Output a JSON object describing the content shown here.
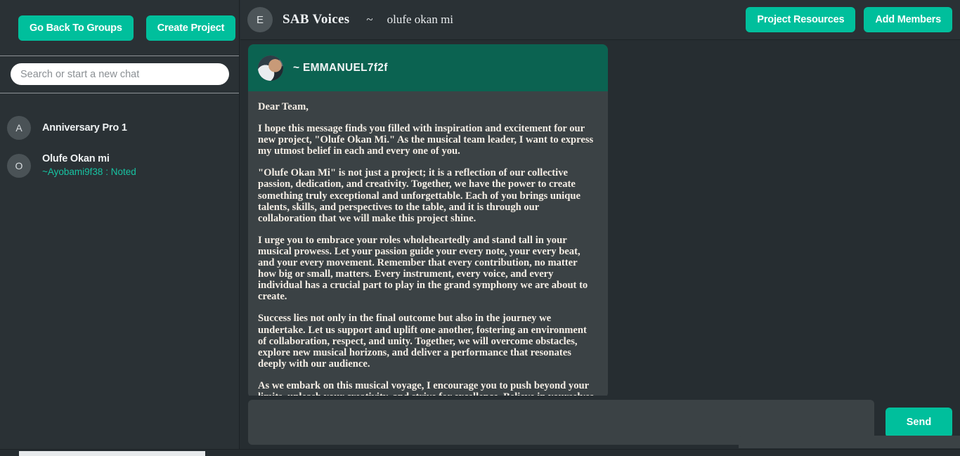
{
  "colors": {
    "accent": "#00bf9c",
    "app_bg": "#262d31",
    "panel_bg": "#2a3135",
    "card_bg": "#3b4245",
    "message_header_bg": "#0b6351",
    "sub_text": "#17c3a2",
    "body_text": "#f4ede4"
  },
  "sidebar": {
    "buttons": [
      {
        "label": "Go Back To Groups",
        "name": "go-back-to-groups-button"
      },
      {
        "label": "Create Project",
        "name": "create-project-button"
      }
    ],
    "search": {
      "placeholder": "Search or start a new chat",
      "value": ""
    },
    "chats": [
      {
        "avatar_initial": "A",
        "name": "Anniversary Pro 1",
        "preview": ""
      },
      {
        "avatar_initial": "O",
        "name": "Olufe Okan mi",
        "preview": "~Ayobami9f38 : Noted"
      }
    ]
  },
  "header": {
    "avatar_initial": "E",
    "title": "SAB Voices",
    "separator": "~",
    "subtitle": "olufe okan mi",
    "buttons": [
      {
        "label": "Project Resources",
        "name": "project-resources-button"
      },
      {
        "label": "Add Members",
        "name": "add-members-button"
      }
    ]
  },
  "message": {
    "sender": "~ EMMANUEL7f2f",
    "avatar_icon": "user-photo-avatar",
    "paragraphs": [
      "Dear Team,",
      "I hope this message finds you filled with inspiration and excitement for our new project, \"Olufe Okan Mi.\" As the musical team leader, I want to express my utmost belief in each and every one of you.",
      "\"Olufe Okan Mi\" is not just a project; it is a reflection of our collective passion, dedication, and creativity. Together, we have the power to create something truly exceptional and unforgettable. Each of you brings unique talents, skills, and perspectives to the table, and it is through our collaboration that we will make this project shine.",
      "I urge you to embrace your roles wholeheartedly and stand tall in your musical prowess. Let your passion guide your every note, your every beat, and your every movement. Remember that every contribution, no matter how big or small, matters. Every instrument, every voice, and every individual has a crucial part to play in the grand symphony we are about to create.",
      "Success lies not only in the final outcome but also in the journey we undertake. Let us support and uplift one another, fostering an environment of collaboration, respect, and unity. Together, we will overcome obstacles, explore new musical horizons, and deliver a performance that resonates deeply with our audience.",
      "As we embark on this musical voyage, I encourage you to push beyond your limits, unleash your creativity, and strive for excellence. Believe in yourselves, trust in one another, and let the music flow through your souls. Our collective harmony will be the defining mark of this journey."
    ]
  },
  "composer": {
    "placeholder": "",
    "value": "",
    "send_label": "Send"
  }
}
